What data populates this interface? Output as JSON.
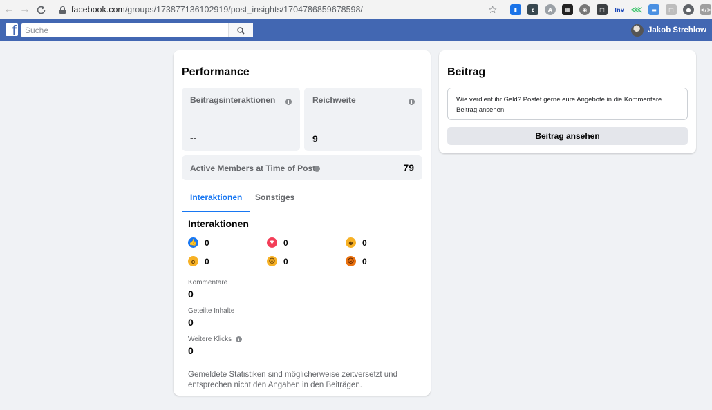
{
  "browser": {
    "url_host": "facebook.com",
    "url_path": "/groups/173877136102919/post_insights/1704786859678598/"
  },
  "topbar": {
    "logo_letter": "f",
    "search_placeholder": "Suche",
    "user_name": "Jakob Strehlow",
    "brand_color": "#4267b2"
  },
  "performance": {
    "title": "Performance",
    "interactions_label": "Beitragsinteraktionen",
    "interactions_value": "--",
    "reach_label": "Reichweite",
    "reach_value": "9",
    "active_members_label": "Active Members at Time of Post",
    "active_members_value": "79",
    "tabs": [
      {
        "label": "Interaktionen",
        "active": true
      },
      {
        "label": "Sonstiges",
        "active": false
      }
    ],
    "section_title": "Interaktionen",
    "reactions": [
      {
        "icon": "like-icon",
        "count": "0"
      },
      {
        "icon": "love-icon",
        "count": "0"
      },
      {
        "icon": "haha-icon",
        "count": "0"
      },
      {
        "icon": "wow-icon",
        "count": "0"
      },
      {
        "icon": "sad-icon",
        "count": "0"
      },
      {
        "icon": "angry-icon",
        "count": "0"
      }
    ],
    "stats": [
      {
        "label": "Kommentare",
        "value": "0"
      },
      {
        "label": "Geteilte Inhalte",
        "value": "0"
      },
      {
        "label": "Weitere Klicks",
        "value": "0"
      }
    ],
    "disclaimer": "Gemeldete Statistiken sind möglicherweise zeitversetzt und entsprechen nicht den Angaben in den Beiträgen."
  },
  "post": {
    "title": "Beitrag",
    "preview_text": "Wie verdient ihr Geld? Postet gerne eure Angebote in die Kommentare",
    "preview_link": "Beitrag ansehen",
    "button_label": "Beitrag ansehen"
  },
  "accent_color": "#1877f2"
}
